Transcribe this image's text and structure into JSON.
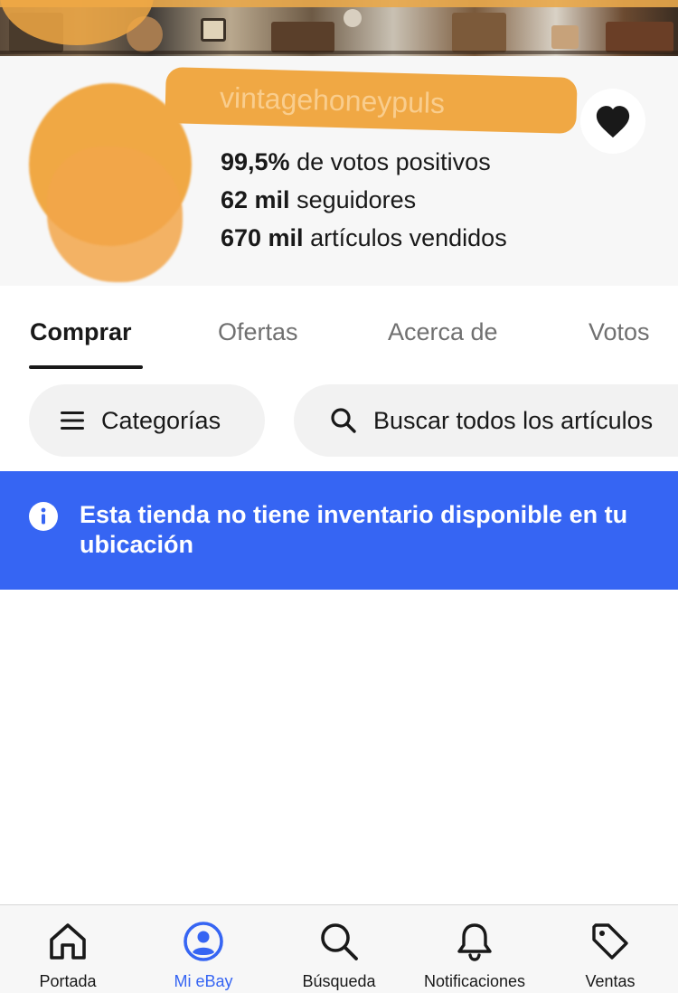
{
  "store": {
    "name": "vintagehoneypuls",
    "feedback_value": "99,5%",
    "feedback_label": "de votos positivos",
    "followers_value": "62 mil",
    "followers_label": "seguidores",
    "sold_value": "670 mil",
    "sold_label": "artículos vendidos"
  },
  "tabs": [
    {
      "label": "Comprar",
      "active": true
    },
    {
      "label": "Ofertas",
      "active": false
    },
    {
      "label": "Acerca de",
      "active": false
    },
    {
      "label": "Votos",
      "active": false
    }
  ],
  "filters": {
    "categories_label": "Categorías",
    "search_placeholder": "Buscar todos los artículos"
  },
  "notice": {
    "text": "Esta tienda no tiene inventario disponible en tu ubicación"
  },
  "bottom_nav": [
    {
      "label": "Portada",
      "icon": "home-icon",
      "active": false
    },
    {
      "label": "Mi eBay",
      "icon": "profile-icon",
      "active": true
    },
    {
      "label": "Búsqueda",
      "icon": "search-icon",
      "active": false
    },
    {
      "label": "Notificaciones",
      "icon": "bell-icon",
      "active": false
    },
    {
      "label": "Ventas",
      "icon": "tag-icon",
      "active": false
    }
  ],
  "colors": {
    "accent": "#3665f3",
    "redaction": "#f0a844",
    "text": "#191919",
    "muted": "#707070"
  }
}
